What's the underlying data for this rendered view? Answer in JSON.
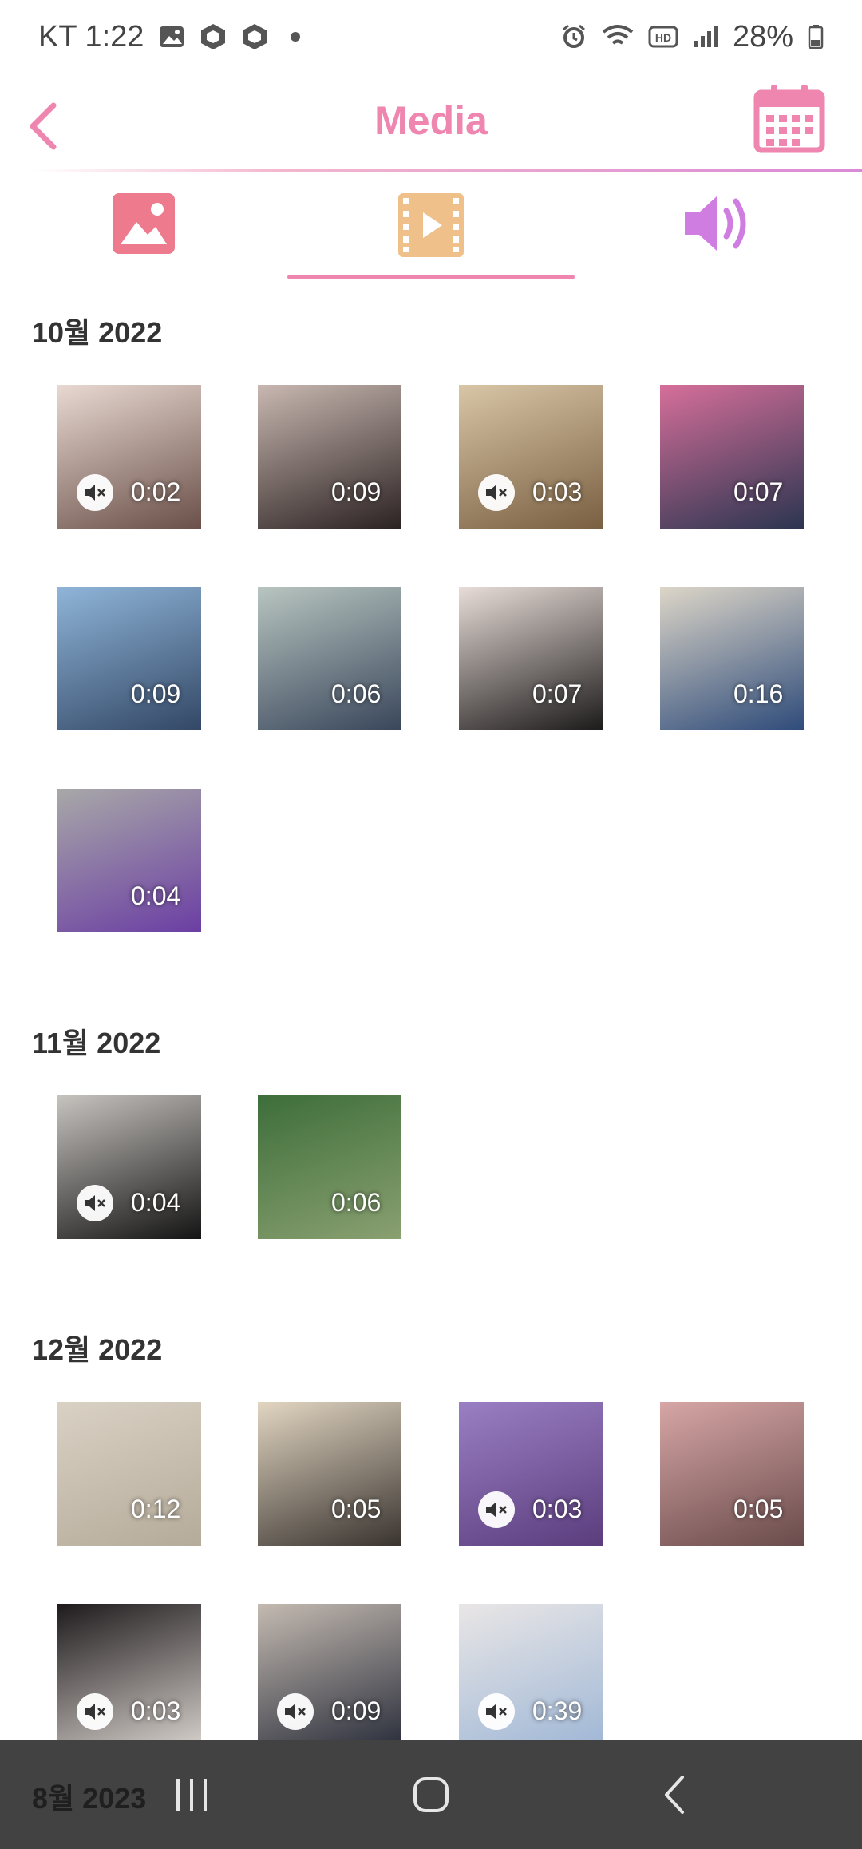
{
  "status_bar": {
    "carrier_time": "KT 1:22",
    "battery": "28%"
  },
  "header": {
    "title": "Media"
  },
  "tabs": [
    {
      "name": "photos",
      "icon": "image-icon",
      "color": "#ee7a8e"
    },
    {
      "name": "videos",
      "icon": "video-icon",
      "color": "#f0c08a",
      "selected": true
    },
    {
      "name": "audio",
      "icon": "speaker-icon",
      "color": "#cf7de0"
    }
  ],
  "sections": [
    {
      "title": "10월 2022",
      "videos": [
        {
          "duration": "0:02",
          "muted": true,
          "colors": [
            "#e8d9d2",
            "#6a5048"
          ]
        },
        {
          "duration": "0:09",
          "muted": false,
          "colors": [
            "#c9b8b1",
            "#2b2222"
          ]
        },
        {
          "duration": "0:03",
          "muted": true,
          "colors": [
            "#d8c6a7",
            "#7a5f41"
          ]
        },
        {
          "duration": "0:07",
          "muted": false,
          "colors": [
            "#d66f9a",
            "#2b3550"
          ]
        },
        {
          "duration": "0:09",
          "muted": false,
          "colors": [
            "#8fb5d8",
            "#334766"
          ]
        },
        {
          "duration": "0:06",
          "muted": false,
          "colors": [
            "#b8c5c0",
            "#39465b"
          ]
        },
        {
          "duration": "0:07",
          "muted": false,
          "colors": [
            "#e8ddd8",
            "#1c1a1a"
          ]
        },
        {
          "duration": "0:16",
          "muted": false,
          "colors": [
            "#ddd6c8",
            "#2e4b7a"
          ]
        },
        {
          "duration": "0:04",
          "muted": false,
          "colors": [
            "#a8a8a8",
            "#6b3ea3"
          ]
        }
      ]
    },
    {
      "title": "11월 2022",
      "videos": [
        {
          "duration": "0:04",
          "muted": true,
          "colors": [
            "#c7c3bf",
            "#141414"
          ]
        },
        {
          "duration": "0:06",
          "muted": false,
          "colors": [
            "#3d6e3a",
            "#8aa071"
          ]
        }
      ]
    },
    {
      "title": "12월 2022",
      "videos": [
        {
          "duration": "0:12",
          "muted": false,
          "colors": [
            "#d9d1c4",
            "#b5ab9a"
          ]
        },
        {
          "duration": "0:05",
          "muted": false,
          "colors": [
            "#e2d6c2",
            "#3a3430"
          ]
        },
        {
          "duration": "0:03",
          "muted": true,
          "colors": [
            "#9a7fc4",
            "#5b3d7d"
          ]
        },
        {
          "duration": "0:05",
          "muted": false,
          "colors": [
            "#d7a6a6",
            "#6a4b4b"
          ]
        },
        {
          "duration": "0:03",
          "muted": true,
          "colors": [
            "#1e1a1c",
            "#d6d0cb"
          ]
        },
        {
          "duration": "0:09",
          "muted": true,
          "colors": [
            "#c4bab1",
            "#2a2e3b"
          ]
        },
        {
          "duration": "0:39",
          "muted": true,
          "colors": [
            "#e9e6e6",
            "#9fb7d6"
          ]
        }
      ]
    }
  ],
  "nav_bar": {
    "date": "8월 2023"
  }
}
